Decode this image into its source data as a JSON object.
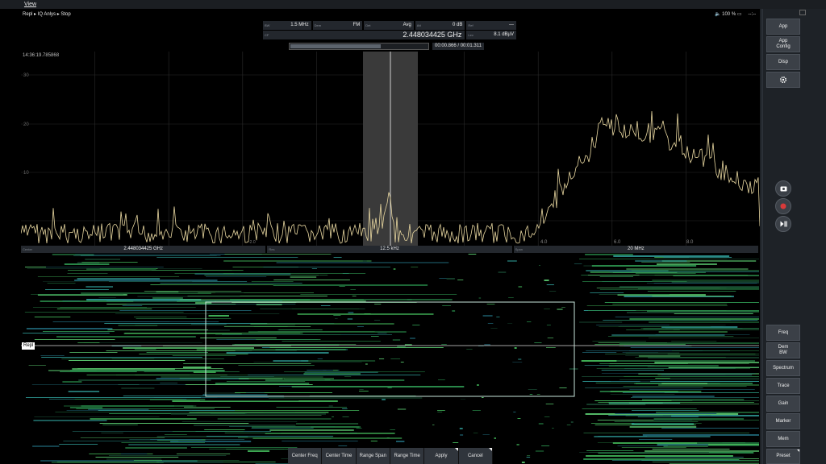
{
  "menu": {
    "view": "View"
  },
  "breadcrumb": "Repl ▸ IQ Anlys ▸ Stop",
  "status": {
    "volume": "🔈 100 % ▭",
    "dash": "--:--"
  },
  "info": {
    "bw_label": "BW",
    "bw_value": "1.5 MHz",
    "dem_label": "Dem",
    "dem_value": "FM",
    "det_label": "Det",
    "det_value": "Avg",
    "att_label": "Att",
    "att_value": "0 dB",
    "ref_label": "Ref",
    "ref_value": "---",
    "cf_label": "CF",
    "cf_value": "2.448034425 GHz",
    "lev_label": "Lev",
    "lev_value": "8.1 dBµV"
  },
  "progress": {
    "time": "00:00.866 / 00:01.311",
    "fraction": 0.66
  },
  "timestamp": "14:36:19.785868",
  "spectrum_axis": {
    "y_ticks": [
      "30",
      "20",
      "10"
    ],
    "x_ticks": [
      "4.0",
      "6.0",
      "8.0"
    ],
    "x_tick_small": "-2.0"
  },
  "spec_bar": {
    "center_label": "Center",
    "center_value": "2.448034425 GHz",
    "res_label": "Res",
    "res_value": "12.5 kHz",
    "span_label": "Span",
    "span_value": "20 MHz"
  },
  "repl_tag": "Repl",
  "bottom_buttons": [
    "Center Freq",
    "Center Time",
    "Range Span",
    "Range Time",
    "Apply",
    "Cancel"
  ],
  "right_top_buttons": [
    "App",
    "App\nConfig",
    "Disp"
  ],
  "right_bottom_buttons": [
    "Freq",
    "Dem\nBW",
    "Spectrum",
    "Trace",
    "Gain",
    "Marker",
    "Mem",
    "Preset"
  ],
  "icons": [
    "settings-gear-icon",
    "camera-icon",
    "record-icon",
    "play-pause-icon"
  ],
  "colors": {
    "trace": "#e8d7a0",
    "highlight": "#3a3a3a",
    "record": "#d83a3a",
    "panel": "#1e2227"
  }
}
